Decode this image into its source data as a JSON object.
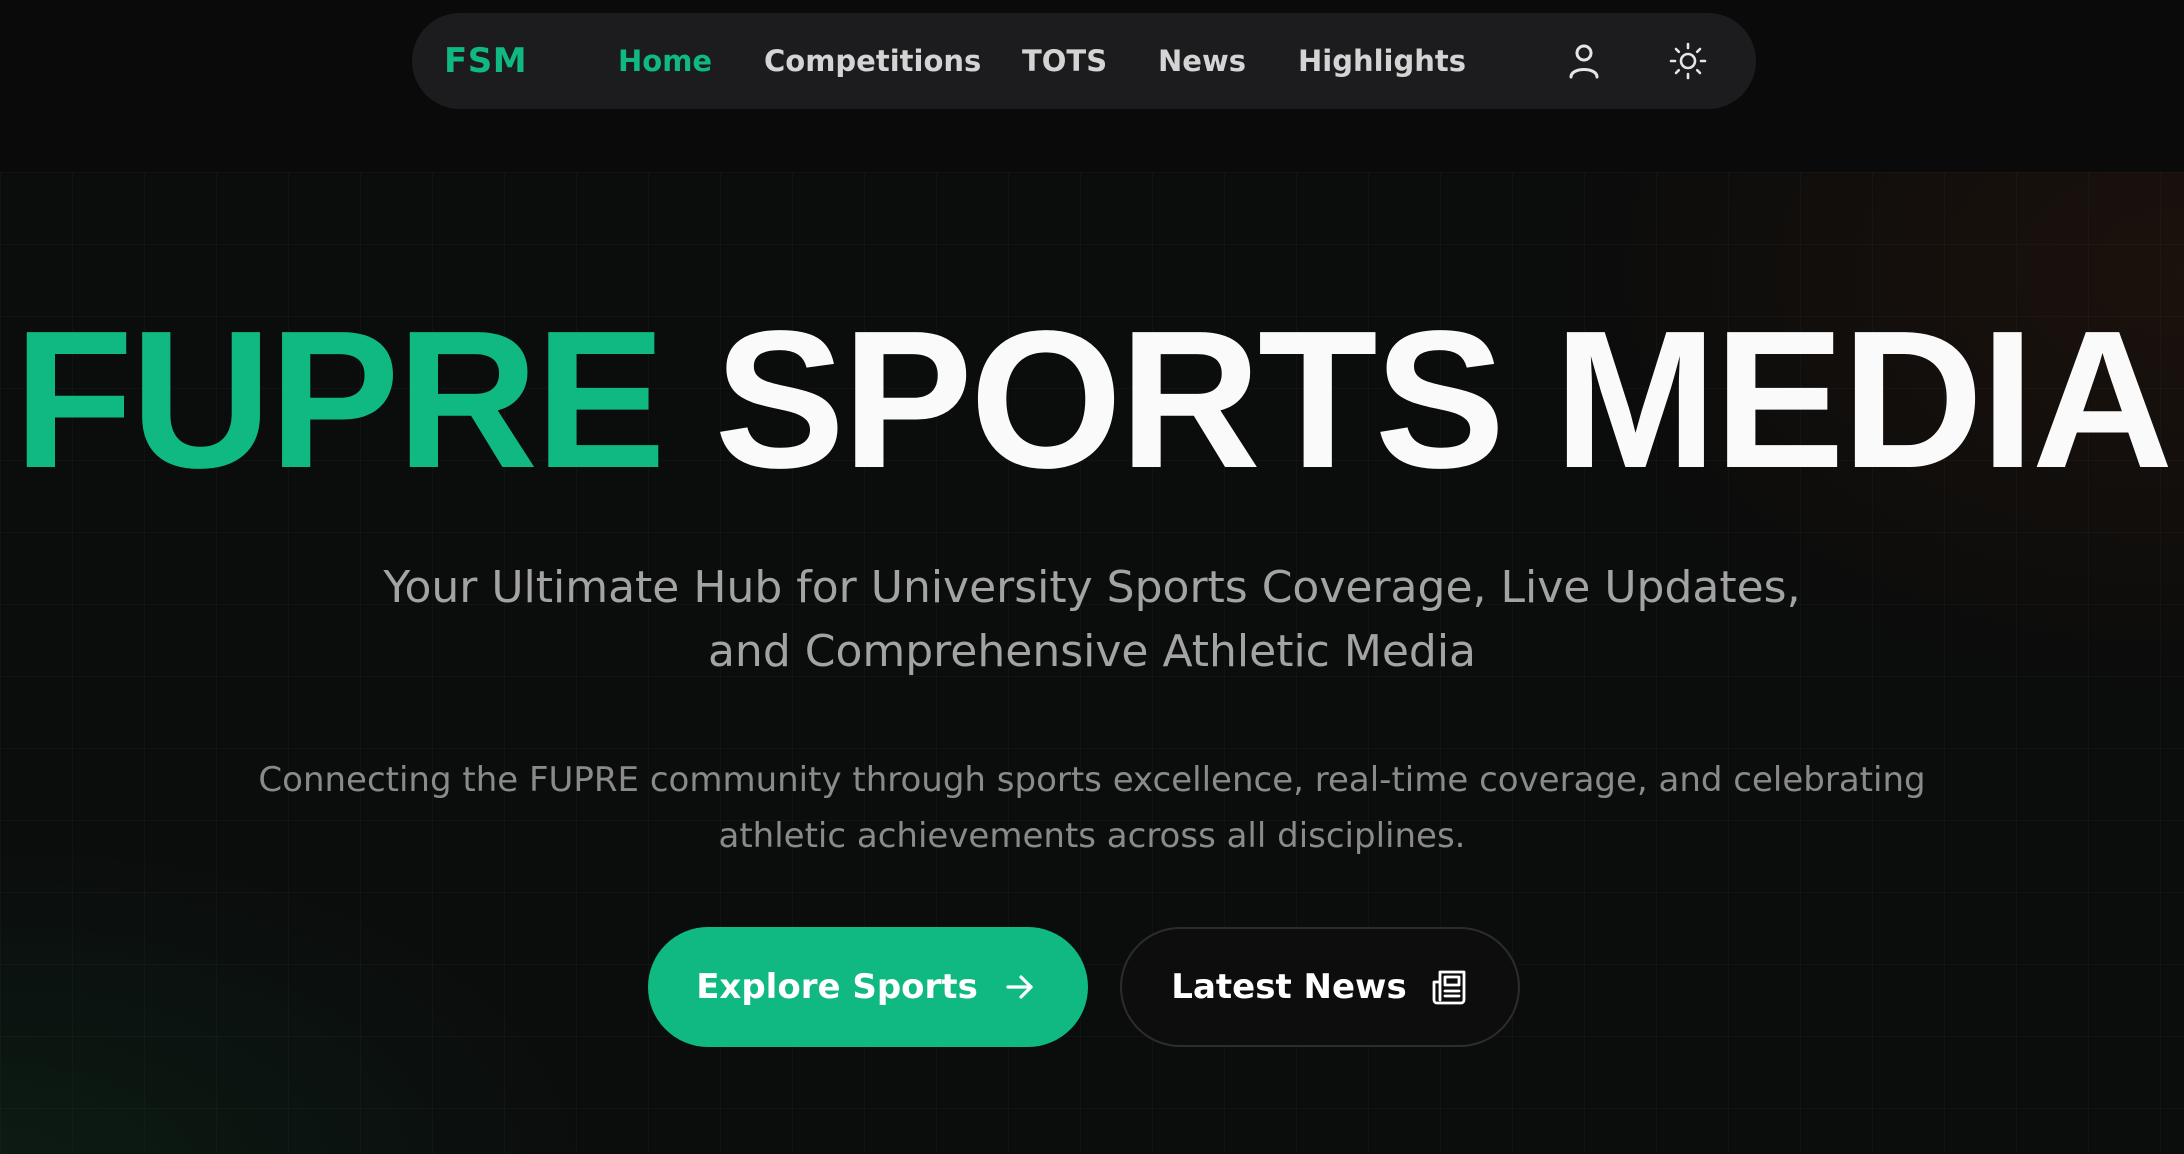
{
  "nav": {
    "brand": "FSM",
    "links": [
      {
        "label": "Home",
        "active": true
      },
      {
        "label": "Competitions",
        "active": false
      },
      {
        "label": "TOTS",
        "active": false
      },
      {
        "label": "News",
        "active": false
      },
      {
        "label": "Highlights",
        "active": false
      }
    ],
    "icons": [
      "user-icon",
      "sun-icon"
    ]
  },
  "hero": {
    "title_highlight": "FUPRE",
    "title_rest": "SPORTS MEDIA",
    "subtitle_line1": "Your Ultimate Hub for University Sports Coverage, Live Updates,",
    "subtitle_line2": "and Comprehensive Athletic Media",
    "description_line1": "Connecting the FUPRE community through sports excellence, real-time coverage, and celebrating",
    "description_line2": "athletic achievements across all disciplines."
  },
  "buttons": {
    "primary_label": "Explore Sports",
    "primary_icon": "arrow-right-icon",
    "secondary_label": "Latest News",
    "secondary_icon": "newspaper-icon"
  },
  "colors": {
    "accent": "#10b981",
    "background": "#0a0a0a",
    "nav_background": "#1c1c1e"
  }
}
